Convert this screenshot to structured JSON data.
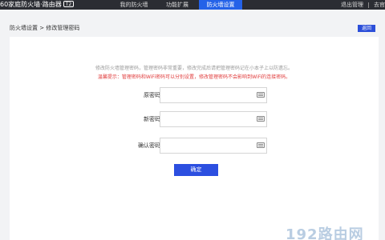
{
  "header": {
    "logo_text": "60家庭防火墙·路由器",
    "logo_badge": "T2",
    "nav": [
      {
        "label": "我的防火墙",
        "active": false
      },
      {
        "label": "功能扩展",
        "active": false
      },
      {
        "label": "防火墙设置",
        "active": true
      }
    ],
    "logout": "退出管理",
    "right_link": "去官"
  },
  "breadcrumb": "防火墙设置 > 修改管理密码",
  "back_button": "返回",
  "hints": {
    "info": "修改防火墙管理密码，管理密码非常重要，修改完成后请把管理密码记在小本子上以防遗忘。",
    "warning": "温馨提示：管理密码和WiFi密码可以分别设置，修改管理密码不会影响到WiFi的连接密码。"
  },
  "form": {
    "old_password_label": "原密码",
    "new_password_label": "新密码",
    "confirm_password_label": "确认密码",
    "submit": "确定"
  },
  "watermark": "192路由网",
  "colors": {
    "topbar": "#2b2d33",
    "accent": "#2c4fe0",
    "warning": "#e03b3b"
  }
}
